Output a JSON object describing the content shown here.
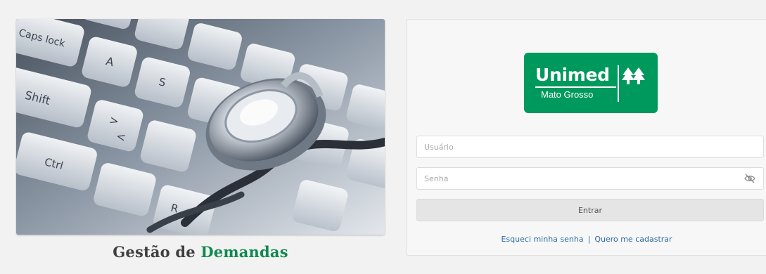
{
  "hero": {
    "caption_prefix": "Gestão de ",
    "caption_accent": "Demandas",
    "keys": [
      "Caps lock",
      "A",
      "Shift",
      ">",
      "<",
      "Ctrl",
      "R",
      "S"
    ]
  },
  "brand": {
    "name": "Unimed",
    "region": "Mato Grosso",
    "color": "#00995d"
  },
  "login": {
    "username_placeholder": "Usuário",
    "username_value": "",
    "password_placeholder": "Senha",
    "password_value": "",
    "submit_label": "Entrar",
    "forgot_label": "Esqueci minha senha",
    "separator": "|",
    "register_label": "Quero me cadastrar"
  },
  "colors": {
    "accent_green": "#0f8a4e",
    "link_blue": "#2a6aa5"
  }
}
